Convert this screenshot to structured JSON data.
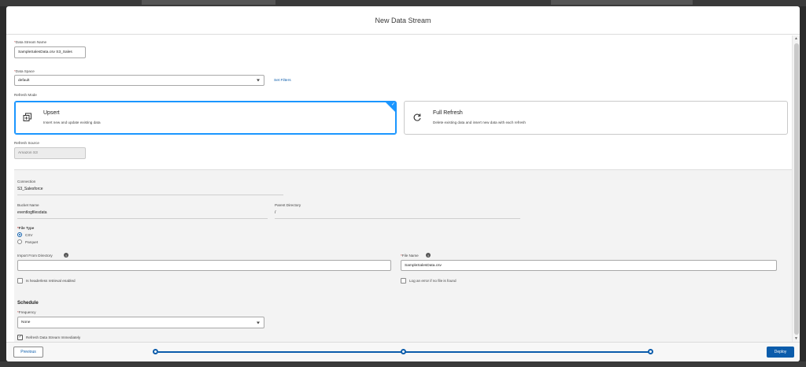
{
  "modal": {
    "title": "New Data Stream"
  },
  "fields": {
    "data_stream_name": {
      "label": "Data Stream Name",
      "value": "SampleSalesData.csv S3_Sales"
    },
    "data_space": {
      "label": "Data Space",
      "value": "default",
      "link": "Set Filters"
    },
    "refresh_mode": {
      "label": "Refresh Mode"
    },
    "refresh_source": {
      "label": "Refresh Source",
      "value": "Amazon S3"
    }
  },
  "refresh_modes": [
    {
      "title": "Upsert",
      "description": "Insert new and update existing data",
      "selected": true
    },
    {
      "title": "Full Refresh",
      "description": "Delete existing data and insert new data with each refresh",
      "selected": false
    }
  ],
  "connection_section": {
    "connection": {
      "label": "Connection",
      "value": "S3_Salesforce"
    },
    "bucket_name": {
      "label": "Bucket Name",
      "value": "eventlogfilesdata"
    },
    "parent_directory": {
      "label": "Parent Directory",
      "value": "/"
    },
    "file_type": {
      "label": "File Type",
      "options": [
        "CSV",
        "Parquet"
      ],
      "selected": "CSV"
    },
    "import_from_directory": {
      "label": "Import From Directory",
      "value": ""
    },
    "file_name": {
      "label": "File Name",
      "value": "SampleSalesData.csv"
    },
    "headerless_checkbox": {
      "label": "Is headerless retrieval enabled",
      "checked": false
    },
    "log_error_checkbox": {
      "label": "Log an error if no file is found",
      "checked": false
    },
    "schedule": {
      "heading": "Schedule",
      "frequency": {
        "label": "Frequency",
        "value": "None"
      },
      "refresh_immediately": {
        "label": "Refresh Data Stream Immediately",
        "checked": true
      }
    }
  },
  "footer": {
    "previous_label": "Previous",
    "deploy_label": "Deploy",
    "progress": {
      "steps": 3,
      "current": 3
    }
  },
  "colors": {
    "brand": "#0b5cab",
    "selected_border": "#1b96ff",
    "required": "#c23934"
  }
}
